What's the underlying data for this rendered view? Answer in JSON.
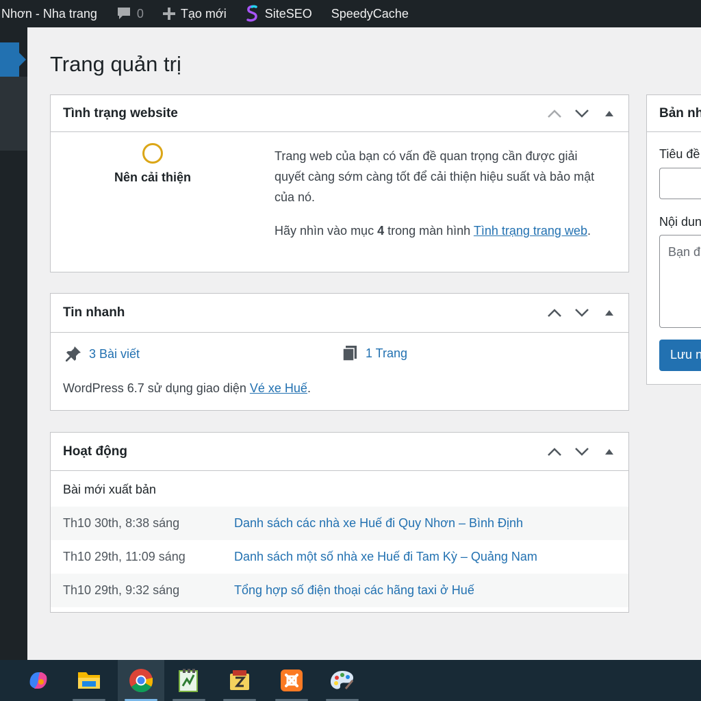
{
  "adminbar": {
    "site_name": "Nhơn - Nha trang",
    "comments_count": "0",
    "new_label": "Tạo mới",
    "siteseo_label": "SiteSEO",
    "speedycache_label": "SpeedyCache"
  },
  "page": {
    "title": "Trang quản trị"
  },
  "site_health": {
    "title": "Tình trạng website",
    "status": "Nên cải thiện",
    "description": "Trang web của bạn có vấn đề quan trọng cần được giải quyết càng sớm càng tốt để cải thiện hiệu suất và bảo mật của nó.",
    "items_prefix": "Hãy nhìn vào mục ",
    "items_count": "4",
    "items_middle": " trong màn hình ",
    "link": "Tình trạng trang web",
    "items_suffix": "."
  },
  "at_a_glance": {
    "title": "Tin nhanh",
    "posts": "3 Bài viết",
    "pages": "1 Trang",
    "wp_prefix": "WordPress 6.7 sử dụng giao diện ",
    "theme": "Vé xe Huế",
    "wp_suffix": "."
  },
  "activity": {
    "title": "Hoạt động",
    "subtitle": "Bài mới xuất bản",
    "rows": [
      {
        "date": "Th10 30th, 8:38 sáng",
        "title": "Danh sách các nhà xe Huế đi Quy Nhơn – Bình Định"
      },
      {
        "date": "Th10 29th, 11:09 sáng",
        "title": "Danh sách một số nhà xe Huế đi Tam Kỳ – Quảng Nam"
      },
      {
        "date": "Th10 29th, 9:32 sáng",
        "title": "Tổng hợp số điện thoại các hãng taxi ở Huế"
      }
    ]
  },
  "quick_draft": {
    "title": "Bản nh",
    "title_label": "Tiêu đề",
    "content_label": "Nội dun",
    "content_placeholder": "Bạn đ",
    "save_label": "Lưu n"
  },
  "taskbar": {
    "apps": [
      "copilot-icon",
      "file-explorer-icon",
      "chrome-icon",
      "notepad-plus-icon",
      "filezilla-icon",
      "xampp-icon",
      "paint-icon"
    ]
  },
  "colors": {
    "accent": "#2271b1",
    "adminbar": "#1d2327",
    "warning": "#dba617",
    "background": "#f0f0f1"
  }
}
